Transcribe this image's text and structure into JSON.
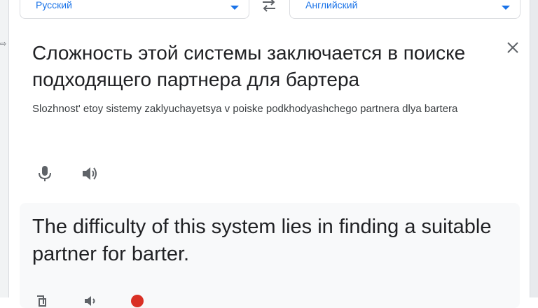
{
  "source_language": {
    "label": "Русский"
  },
  "target_language": {
    "label": "Английский"
  },
  "icons": {
    "swap": "swap-arrows-icon",
    "close": "close-icon",
    "mic": "microphone-icon",
    "speaker": "speaker-icon"
  },
  "source": {
    "text": "Сложность этой системы заключается в поиске подходящего партнера для бартера",
    "transliteration": "Slozhnost' etoy sistemy zaklyuchayetsya v poiske podkhodyashchego partnera dlya bartera"
  },
  "result": {
    "text": "The difficulty of this system lies in finding a suitable partner for barter."
  },
  "colors": {
    "accent": "#1a73e8",
    "icon": "#5f6368",
    "text": "#202124",
    "card_bg": "#f8f9fa",
    "border": "#dadce0"
  }
}
